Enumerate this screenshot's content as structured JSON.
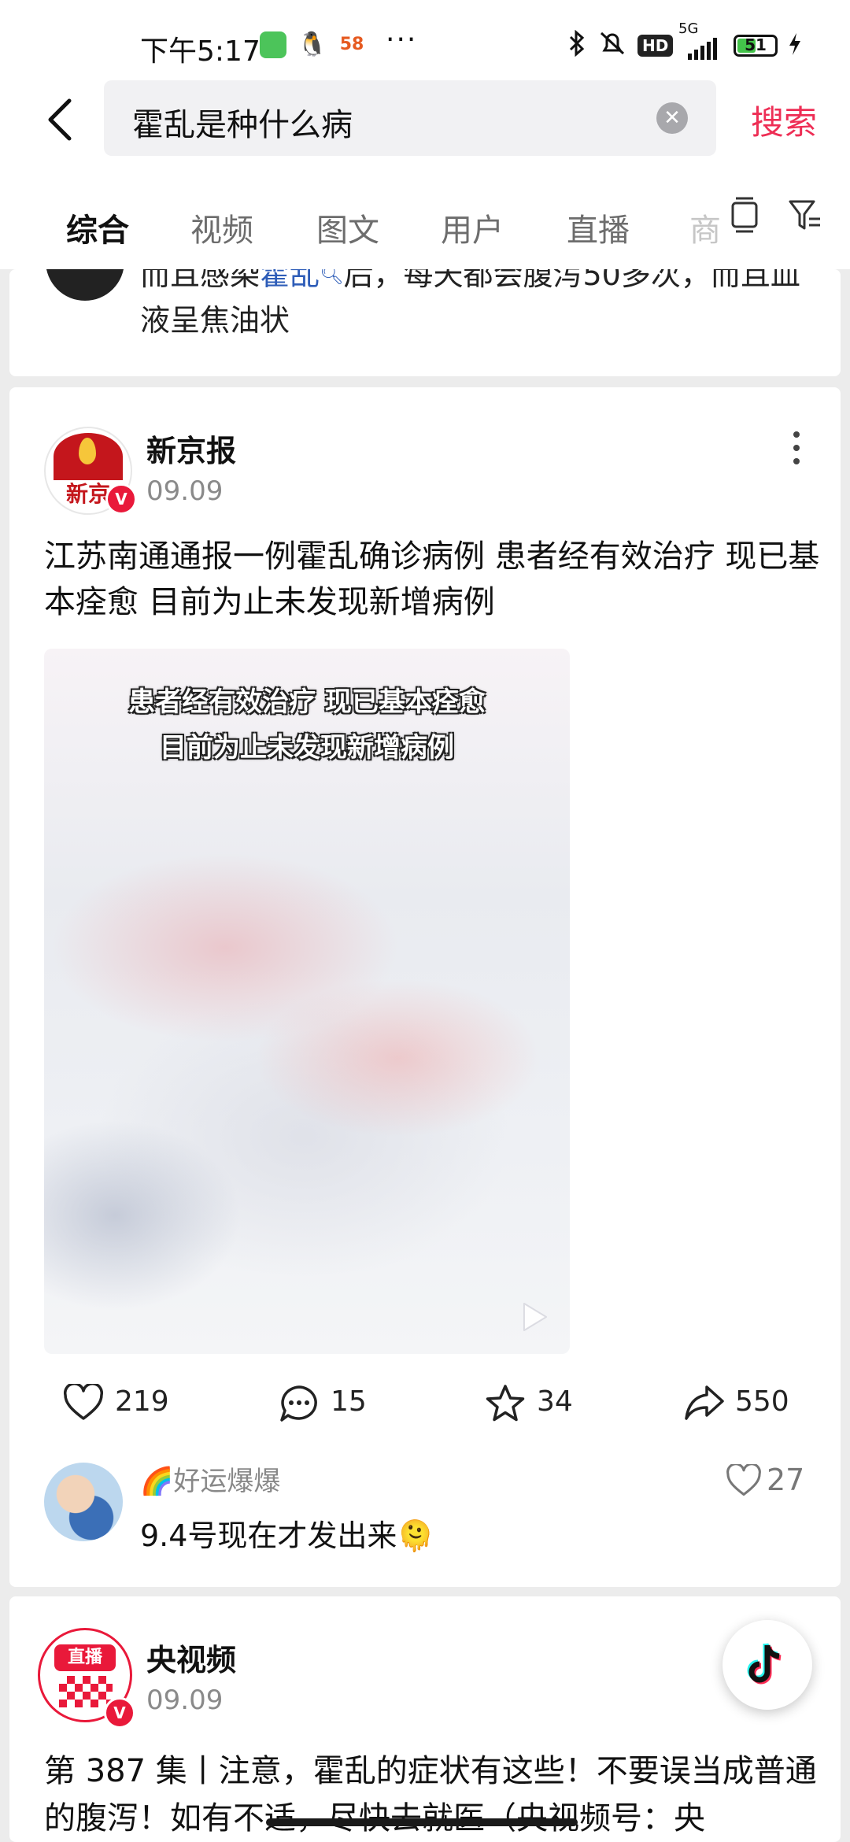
{
  "status_bar": {
    "time": "下午5:17",
    "more": "···",
    "hd": "HD",
    "network": "5G",
    "battery": 51,
    "battery_text": "51",
    "app_58": "58"
  },
  "search": {
    "query": "霍乱是种什么病",
    "search_label": "搜索"
  },
  "tabs": [
    {
      "label": "综合",
      "active": true
    },
    {
      "label": "视频",
      "active": false
    },
    {
      "label": "图文",
      "active": false
    },
    {
      "label": "用户",
      "active": false
    },
    {
      "label": "直播",
      "active": false
    },
    {
      "label": "商",
      "active": false
    }
  ],
  "previous_card": {
    "text_before": "而且感染",
    "link": "霍乱",
    "text_after": "后，每天都会腹泻50多次，而且血液呈焦油状"
  },
  "post": {
    "author": "新京报",
    "avatar_text": "新京",
    "verified": "V",
    "date": "09.09",
    "text": "江苏南通通报一例霍乱确诊病例 患者经有效治疗 现已基本痊愈 目前为止未发现新增病例",
    "video_caption_1": "患者经有效治疗 现已基本痊愈",
    "video_caption_2": "目前为止未发现新增病例",
    "likes": "219",
    "comments": "15",
    "favorites": "34",
    "shares": "550",
    "top_comment": {
      "user": "🌈好运爆爆",
      "text": "9.4号现在才发出来🫠",
      "likes": "27"
    }
  },
  "next_post": {
    "author": "央视频",
    "avatar_text": "直播",
    "verified": "V",
    "date": "09.09",
    "text": "第 387 集丨注意，霍乱的症状有这些！不要误当成普通的腹泻！如有不适，尽快去就医（央视频号：央"
  },
  "colors": {
    "accent": "#ee2e55",
    "link": "#2e5db8",
    "verified": "#e9193a"
  }
}
